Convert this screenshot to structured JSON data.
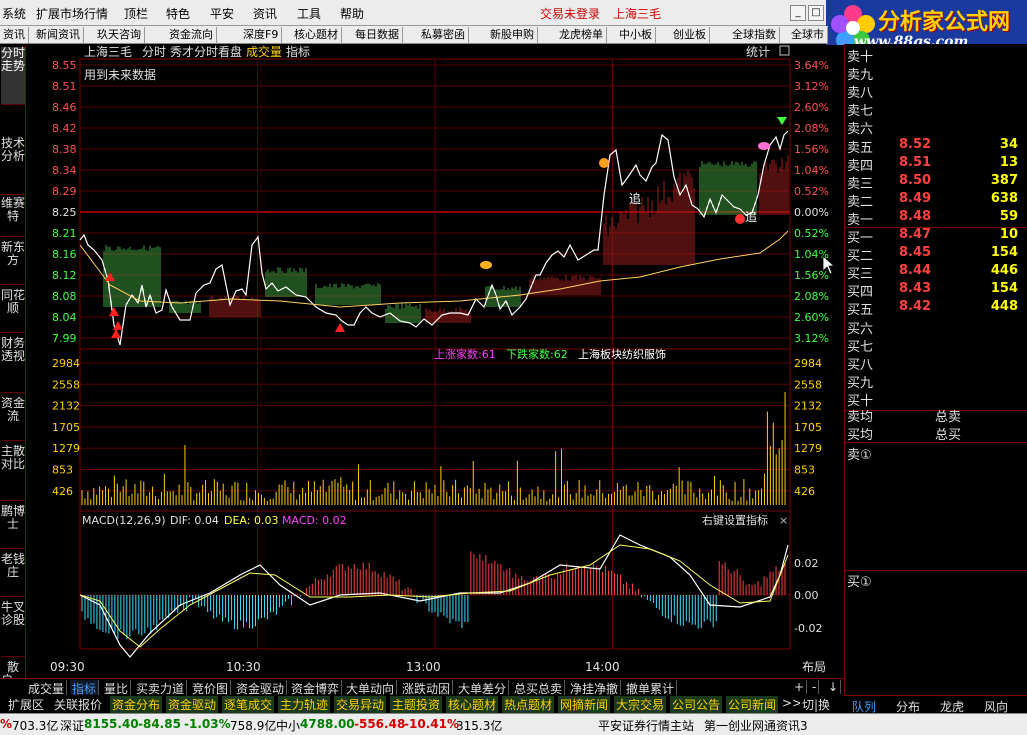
{
  "menu": {
    "items": [
      "系统",
      "扩展市场行情",
      "顶栏",
      "特色",
      "平安",
      "资讯",
      "工具",
      "帮助"
    ],
    "login": "交易未登录",
    "stock": "上海三毛"
  },
  "logo": {
    "title": "分析家公式网",
    "url": "www.88gs.com"
  },
  "toolbar": [
    "资讯",
    "新闻资讯",
    "玖天咨询",
    "资金流向",
    "深度F9",
    "核心题材",
    "每日数据",
    "私募密函",
    "新股申购",
    "龙虎榜单",
    "中小板",
    "创业板",
    "全球指数",
    "全球市"
  ],
  "left_rail": [
    "分时走势",
    "技术分析",
    "维赛特",
    "新东方",
    "同花顺",
    "财务透视",
    "资金流",
    "主散对比",
    "鹏博士",
    "老钱庄",
    "牛叉诊股",
    "散户..."
  ],
  "chart": {
    "header": {
      "name": "上海三毛",
      "mode": "分时",
      "sub": "秀才分时看盘",
      "vol": "成交量",
      "ind": "指标",
      "stats": "统计"
    },
    "warn": "用到未来数据",
    "price_labels": [
      "8.55",
      "8.51",
      "8.46",
      "8.42",
      "8.38",
      "8.34",
      "8.29",
      "8.25",
      "8.21",
      "8.16",
      "8.12",
      "8.08",
      "8.04",
      "7.99"
    ],
    "pct_labels": [
      "3.64%",
      "3.12%",
      "2.60%",
      "2.08%",
      "1.56%",
      "1.04%",
      "0.52%",
      "0.00%",
      "0.52%",
      "1.04%",
      "1.56%",
      "2.08%",
      "2.60%",
      "3.12%"
    ],
    "vol_labels": [
      "2984",
      "2558",
      "2132",
      "1705",
      "1279",
      "853",
      "426"
    ],
    "market_info": {
      "up": "上涨家数:61",
      "down": "下跌家数:62",
      "sector": "上海板块纺织服饰"
    },
    "macd": {
      "title": "MACD(12,26,9)",
      "dif": "DIF: 0.04",
      "dea": "DEA: 0.03",
      "macd": "MACD: 0.02",
      "settings": "右键设置指标",
      "ticks": [
        "0.02",
        "0.00",
        "-0.02"
      ]
    },
    "time_labels": [
      "09:30",
      "10:30",
      "13:00",
      "14:00"
    ],
    "layout_btn": "布局",
    "markers": {
      "chase": "追"
    }
  },
  "orderbook": {
    "asks": [
      {
        "label": "卖十",
        "price": "",
        "vol": ""
      },
      {
        "label": "卖九",
        "price": "",
        "vol": ""
      },
      {
        "label": "卖八",
        "price": "",
        "vol": ""
      },
      {
        "label": "卖七",
        "price": "",
        "vol": ""
      },
      {
        "label": "卖六",
        "price": "",
        "vol": ""
      },
      {
        "label": "卖五",
        "price": "8.52",
        "vol": "34"
      },
      {
        "label": "卖四",
        "price": "8.51",
        "vol": "13"
      },
      {
        "label": "卖三",
        "price": "8.50",
        "vol": "387"
      },
      {
        "label": "卖二",
        "price": "8.49",
        "vol": "638"
      },
      {
        "label": "卖一",
        "price": "8.48",
        "vol": "59"
      }
    ],
    "bids": [
      {
        "label": "买一",
        "price": "8.47",
        "vol": "10"
      },
      {
        "label": "买二",
        "price": "8.45",
        "vol": "154"
      },
      {
        "label": "买三",
        "price": "8.44",
        "vol": "446"
      },
      {
        "label": "买四",
        "price": "8.43",
        "vol": "154"
      },
      {
        "label": "买五",
        "price": "8.42",
        "vol": "448"
      },
      {
        "label": "买六",
        "price": "",
        "vol": ""
      },
      {
        "label": "买七",
        "price": "",
        "vol": ""
      },
      {
        "label": "买八",
        "price": "",
        "vol": ""
      },
      {
        "label": "买九",
        "price": "",
        "vol": ""
      },
      {
        "label": "买十",
        "price": "",
        "vol": ""
      }
    ],
    "avg_sell": "卖均",
    "avg_buy": "买均",
    "total_sell": "总卖",
    "total_buy": "总买",
    "sell1": "卖①",
    "buy1": "买①"
  },
  "right_tabs": [
    "队列",
    "分布",
    "龙虎",
    "风向"
  ],
  "bottom_tabs": [
    "成交量",
    "指标",
    "量比",
    "买卖力道",
    "竞价图",
    "资金驱动",
    "资金博弈",
    "大单动向",
    "涨跌动因",
    "大单差分",
    "总买总卖",
    "净挂净撤",
    "撤单累计"
  ],
  "bottom_ctrls": [
    "+",
    "-",
    "↓"
  ],
  "module_tabs": [
    "扩展区",
    "关联报价",
    "资金分布",
    "资金驱动",
    "逐笔成交",
    "主力轨迹",
    "交易异动",
    "主题投资",
    "核心题材",
    "热点题材",
    "网摘新闻",
    "大宗交易",
    "公司公告",
    "公司新闻",
    ">>",
    "切|换"
  ],
  "status": {
    "a": "%",
    "a_amt": "703.3亿",
    "sz_name": "深证",
    "sz_val": "8155.40",
    "sz_chg": "-84.85",
    "sz_pct": "-1.03%",
    "sz_amt": "758.9亿",
    "zx_name": "中小",
    "zx_val": "4788.00",
    "zx_chg": "-556.48",
    "zx_pct": "-10.41%",
    "zx_amt": "315.3亿",
    "broker": "平安证券行情主站",
    "news": "第一创业网通资讯3"
  }
}
